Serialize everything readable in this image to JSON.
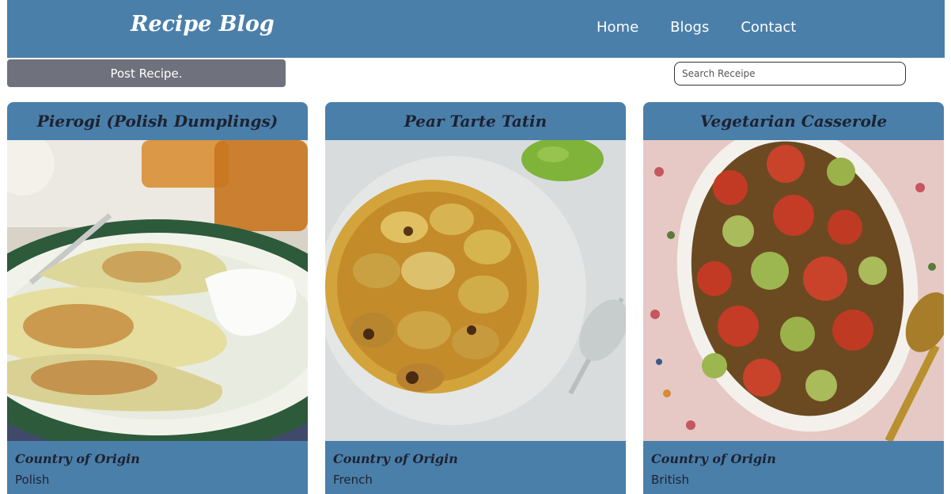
{
  "nav": {
    "brand": "Recipe Blog",
    "links": [
      "Home",
      "Blogs",
      "Contact"
    ]
  },
  "toolbar": {
    "post_label": "Post Recipe.",
    "search_placeholder": "Search Receipe"
  },
  "cards": [
    {
      "title": "Pierogi (Polish Dumplings)",
      "origin_label": "Country of Origin",
      "origin": "Polish"
    },
    {
      "title": "Pear Tarte Tatin",
      "origin_label": "Country of Origin",
      "origin": "French"
    },
    {
      "title": "Vegetarian Casserole",
      "origin_label": "Country of Origin",
      "origin": "British"
    }
  ],
  "colors": {
    "navbar": "#4a7faa",
    "post_button": "#6f717c",
    "card": "#4a7faa"
  }
}
